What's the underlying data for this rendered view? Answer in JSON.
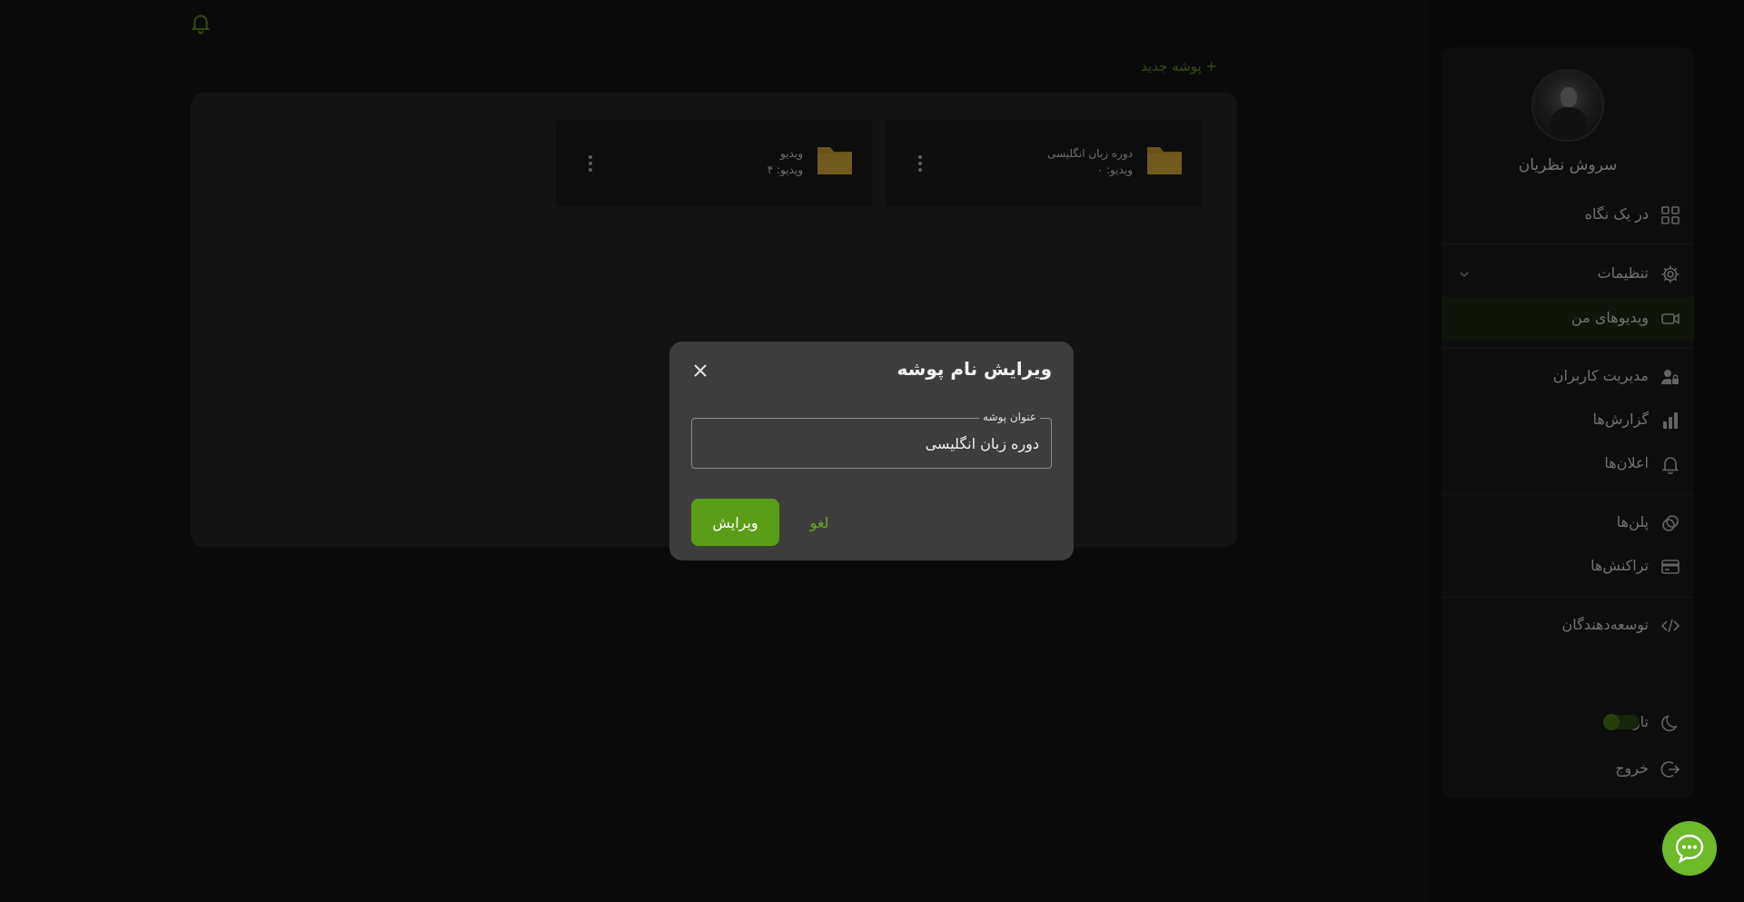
{
  "header": {
    "new_folder_label": "+ پوشه جدید"
  },
  "folders": [
    {
      "name": "دوره زبان انگلیسی",
      "count": "ویدیو: ۰"
    },
    {
      "name": "ویدیو",
      "count": "ویدیو: ۴"
    }
  ],
  "sidebar": {
    "user_name": "سروش نظریان",
    "items": [
      {
        "label": "در یک نگاه",
        "icon": "grid-icon"
      },
      {
        "label": "تنظیمات",
        "icon": "gear-icon"
      },
      {
        "label": "ویدیوهای من",
        "icon": "video-icon",
        "active": true
      },
      {
        "label": "مدیریت کاربران",
        "icon": "user-lock-icon"
      },
      {
        "label": "گزارش‌ها",
        "icon": "bar-chart-icon"
      },
      {
        "label": "اعلان‌ها",
        "icon": "bell-icon"
      },
      {
        "label": "پلن‌ها",
        "icon": "coins-icon"
      },
      {
        "label": "تراکنش‌ها",
        "icon": "credit-card-icon"
      },
      {
        "label": "توسعه‌دهندگان",
        "icon": "code-icon"
      }
    ],
    "theme_label": "تاریک",
    "logout_label": "خروج"
  },
  "dialog": {
    "title": "ویرایش نام پوشه",
    "field_label": "عنوان پوشه",
    "field_value": "دوره زبان انگلیسی",
    "submit_label": "ویرایش",
    "cancel_label": "لغو"
  },
  "colors": {
    "accent": "#5a9e17",
    "background": "#141414",
    "dialog": "#3d3d3d",
    "folder": "#d4a72c"
  }
}
